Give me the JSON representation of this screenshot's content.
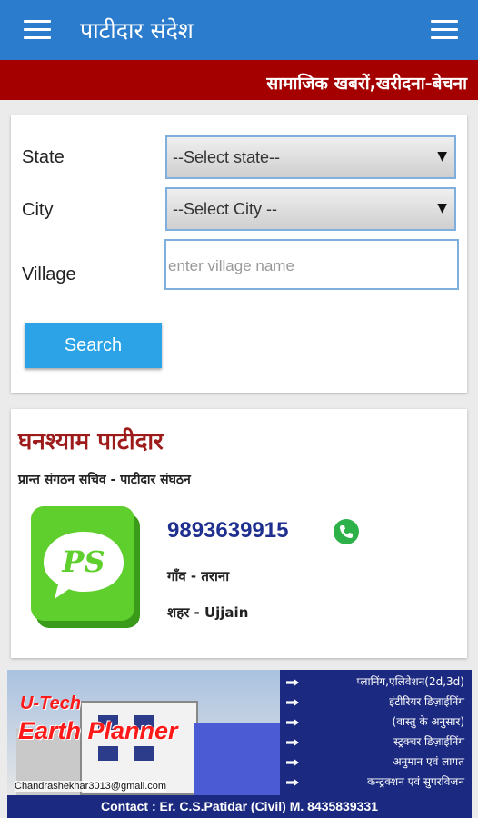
{
  "app": {
    "title": "पाटीदार संदेश"
  },
  "banner": {
    "text": "सामाजिक खबरों,खरीदना-बेचना"
  },
  "search_form": {
    "state_label": "State",
    "state_value": "--Select state--",
    "city_label": "City",
    "city_value": "--Select City --",
    "village_label": "Village",
    "village_placeholder": "enter village name",
    "search_button": "Search"
  },
  "profile": {
    "name": "घनश्याम पाटीदार",
    "role": "प्रान्त संगठन सचिव  -   पाटीदार संघठन",
    "logo_text": "PS",
    "phone": "9893639915",
    "village": "गाँव - तराना",
    "city": "शहर - Ujjain"
  },
  "ad": {
    "brand_line1": "U-Tech",
    "brand_line2": "Earth Planner",
    "email": "Chandrashekhar3013@gmail.com",
    "services": [
      "प्लानिंग,एलिवेशन(2d,3d)",
      "इंटीरियर डिज़ाईनिंग",
      "(वास्तु के अनुसार)",
      "स्ट्रक्चर डिज़ाईनिंग",
      "अनुमान एवं लागत",
      "कन्ट्रक्शन एवं सुपरविजन"
    ],
    "contact": "Contact : Er. C.S.Patidar (Civil) M. 8435839331"
  },
  "colors": {
    "appbar": "#2b7ccd",
    "banner": "#a40000",
    "button": "#2ba3e6",
    "logo_green": "#5fcf2e",
    "name_red": "#9e1b1b",
    "phone_blue": "#1f2f8f"
  }
}
